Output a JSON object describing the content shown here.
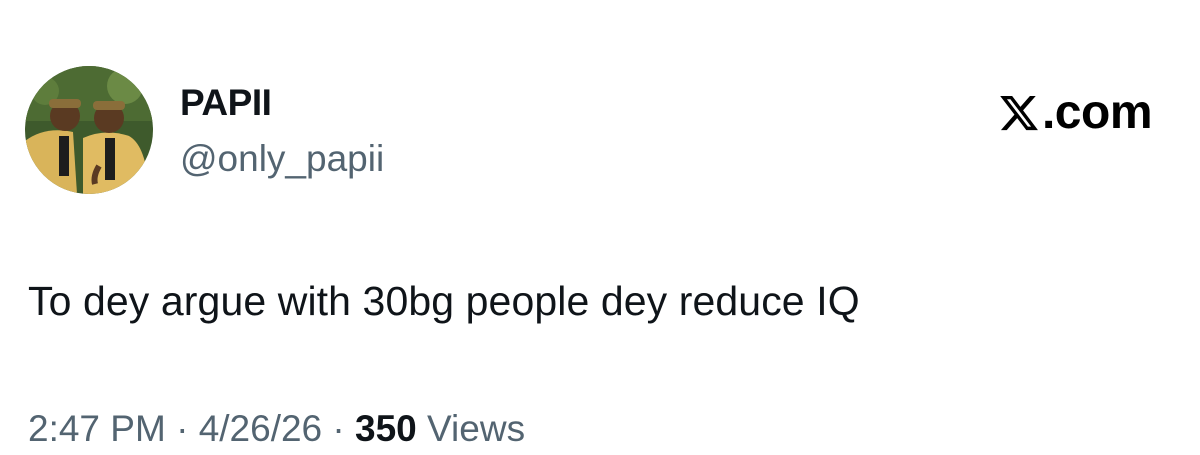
{
  "author": {
    "display_name": "PAPII",
    "handle": "@only_papii",
    "avatar": "profile-photo"
  },
  "brand": {
    "logo_icon": "x-logo-icon",
    "text": ".com"
  },
  "tweet": {
    "text": "To dey argue with 30bg people dey reduce IQ"
  },
  "meta": {
    "time": "2:47 PM",
    "separator": "·",
    "date": "4/26/26",
    "views_count": "350",
    "views_label": "Views"
  },
  "colors": {
    "primary_text": "#0f1419",
    "secondary_text": "#536471",
    "background": "#ffffff"
  }
}
